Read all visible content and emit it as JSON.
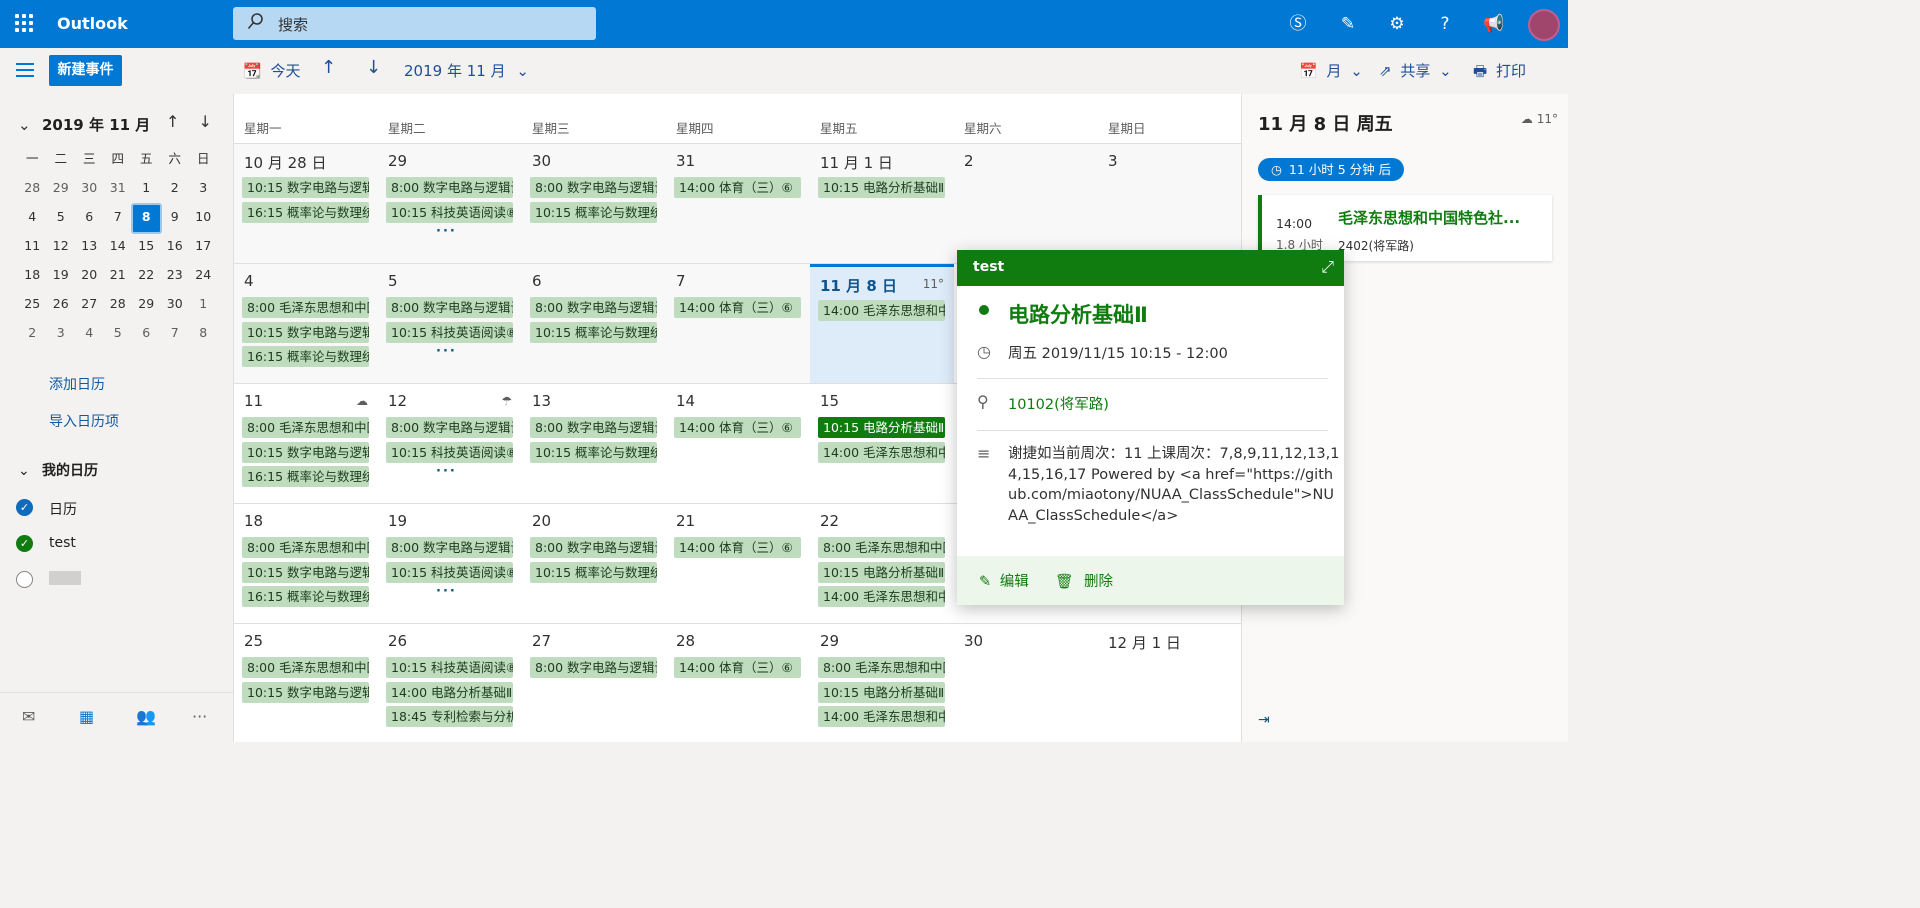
{
  "topbar": {
    "app_name": "Outlook",
    "search_placeholder": "搜索"
  },
  "toolbar": {
    "new_event": "新建事件",
    "today": "今天",
    "month_label": "2019 年 11 月",
    "view": "月",
    "share": "共享",
    "print": "打印"
  },
  "mini_calendar": {
    "title": "2019 年 11 月",
    "weekdays": [
      "一",
      "二",
      "三",
      "四",
      "五",
      "六",
      "日"
    ],
    "rows": [
      [
        "28",
        "29",
        "30",
        "31",
        "1",
        "2",
        "3"
      ],
      [
        "4",
        "5",
        "6",
        "7",
        "8",
        "9",
        "10"
      ],
      [
        "11",
        "12",
        "13",
        "14",
        "15",
        "16",
        "17"
      ],
      [
        "18",
        "19",
        "20",
        "21",
        "22",
        "23",
        "24"
      ],
      [
        "25",
        "26",
        "27",
        "28",
        "29",
        "30",
        "1"
      ],
      [
        "2",
        "3",
        "4",
        "5",
        "6",
        "7",
        "8"
      ]
    ],
    "selected": "8"
  },
  "leftnav": {
    "add_calendar": "添加日历",
    "import_calendar": "导入日历项",
    "my_calendars": "我的日历",
    "calendars": [
      {
        "label": "日历",
        "color": "#0f6cbd",
        "checked": true
      },
      {
        "label": "test",
        "color": "#107c10",
        "checked": true
      },
      {
        "label": "",
        "color": "#ffffff",
        "checked": false
      }
    ]
  },
  "grid": {
    "weekdays": [
      "星期一",
      "星期二",
      "星期三",
      "星期四",
      "星期五",
      "星期六",
      "星期日"
    ],
    "weeks": [
      [
        {
          "num": "10 月 28 日",
          "events": [
            "10:15 数字电路与逻辑",
            "16:15 概率论与数理统"
          ]
        },
        {
          "num": "29",
          "events": [
            "8:00 数字电路与逻辑设",
            "10:15 科技英语阅读⑧"
          ],
          "more": true
        },
        {
          "num": "30",
          "events": [
            "8:00 数字电路与逻辑设",
            "10:15 概率论与数理统"
          ]
        },
        {
          "num": "31",
          "events": [
            "14:00 体育（三）⑥"
          ]
        },
        {
          "num": "11 月 1 日",
          "events": [
            "10:15 电路分析基础Ⅱ"
          ]
        },
        {
          "num": "2",
          "events": []
        },
        {
          "num": "3",
          "events": []
        }
      ],
      [
        {
          "num": "4",
          "events": [
            "8:00 毛泽东思想和中国",
            "10:15 数字电路与逻辑",
            "16:15 概率论与数理统"
          ]
        },
        {
          "num": "5",
          "events": [
            "8:00 数字电路与逻辑设",
            "10:15 科技英语阅读⑧"
          ],
          "more": true
        },
        {
          "num": "6",
          "events": [
            "8:00 数字电路与逻辑设",
            "10:15 概率论与数理统"
          ]
        },
        {
          "num": "7",
          "events": [
            "14:00 体育（三）⑥"
          ]
        },
        {
          "num": "11 月 8 日",
          "weather": "11°",
          "today": true,
          "events": [
            "14:00 毛泽东思想和中"
          ]
        },
        {
          "num": "",
          "events": []
        },
        {
          "num": "",
          "events": []
        }
      ],
      [
        {
          "num": "11",
          "weather": "☁",
          "events": [
            "8:00 毛泽东思想和中国",
            "10:15 数字电路与逻辑",
            "16:15 概率论与数理统"
          ]
        },
        {
          "num": "12",
          "weather": "☂",
          "events": [
            "8:00 数字电路与逻辑设",
            "10:15 科技英语阅读⑧"
          ],
          "more": true
        },
        {
          "num": "13",
          "events": [
            "8:00 数字电路与逻辑设",
            "10:15 概率论与数理统"
          ]
        },
        {
          "num": "14",
          "events": [
            "14:00 体育（三）⑥"
          ]
        },
        {
          "num": "15",
          "events": [
            "10:15 电路分析基础Ⅱ",
            "14:00 毛泽东思想和中"
          ],
          "selected": 0
        },
        {
          "num": "",
          "events": []
        },
        {
          "num": "",
          "events": []
        }
      ],
      [
        {
          "num": "18",
          "events": [
            "8:00 毛泽东思想和中国",
            "10:15 数字电路与逻辑",
            "16:15 概率论与数理统"
          ]
        },
        {
          "num": "19",
          "events": [
            "8:00 数字电路与逻辑设",
            "10:15 科技英语阅读⑧"
          ],
          "more": true
        },
        {
          "num": "20",
          "events": [
            "8:00 数字电路与逻辑设",
            "10:15 概率论与数理统"
          ]
        },
        {
          "num": "21",
          "events": [
            "14:00 体育（三）⑥"
          ]
        },
        {
          "num": "22",
          "events": [
            "8:00 毛泽东思想和中国",
            "10:15 电路分析基础Ⅱ",
            "14:00 毛泽东思想和中"
          ]
        },
        {
          "num": "",
          "events": []
        },
        {
          "num": "",
          "events": []
        }
      ],
      [
        {
          "num": "25",
          "events": [
            "8:00 毛泽东思想和中国",
            "10:15 数字电路与逻辑"
          ]
        },
        {
          "num": "26",
          "events": [
            "10:15 科技英语阅读⑧",
            "14:00 电路分析基础Ⅱ",
            "18:45 专利检索与分析"
          ]
        },
        {
          "num": "27",
          "events": [
            "8:00 数字电路与逻辑设"
          ]
        },
        {
          "num": "28",
          "events": [
            "14:00 体育（三）⑥"
          ]
        },
        {
          "num": "29",
          "events": [
            "8:00 毛泽东思想和中国",
            "10:15 电路分析基础Ⅱ",
            "14:00 毛泽东思想和中"
          ]
        },
        {
          "num": "30",
          "events": []
        },
        {
          "num": "12 月 1 日",
          "events": []
        }
      ]
    ]
  },
  "right_pane": {
    "title": "11 月 8 日 周五",
    "weather": "11°",
    "countdown": "11 小时 5 分钟 后",
    "event_time": "14:00",
    "event_duration": "1.8 小时",
    "event_title": "毛泽东思想和中国特色社...",
    "event_location": "2402(将军路)"
  },
  "popup": {
    "calendar_name": "test",
    "title": "电路分析基础Ⅱ",
    "when": "周五 2019/11/15 10:15 - 12:00",
    "location": "10102(将军路)",
    "description": "谢捷如当前周次：11 上课周次：7,8,9,11,12,13,14,15,16,17 Powered by <a href=\"https://github.com/miaotony/NUAA_ClassSchedule\">NUAA_ClassSchedule</a>",
    "edit": "编辑",
    "delete": "删除"
  }
}
